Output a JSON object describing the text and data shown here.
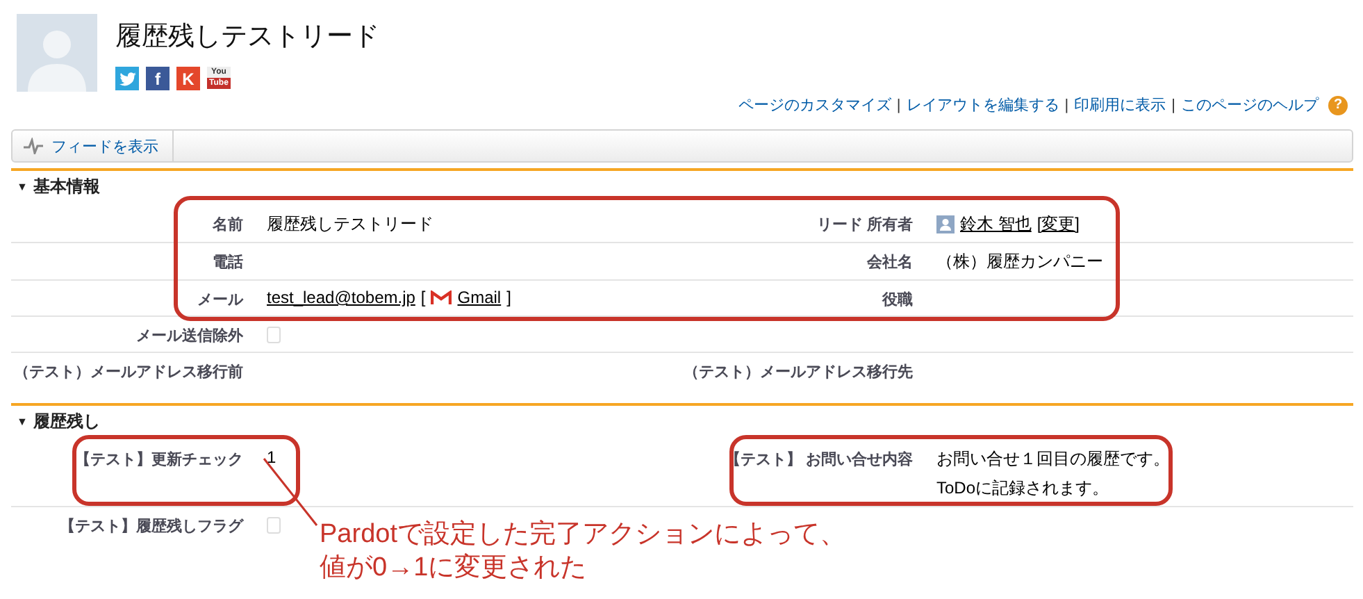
{
  "record": {
    "title": "履歴残しテストリード",
    "social_icons": [
      {
        "kind": "bird",
        "color": "#2fa6dd"
      },
      {
        "kind": "letter",
        "glyph": "f",
        "color": "#3b5998"
      },
      {
        "kind": "letter",
        "glyph": "K",
        "color": "#e4472b"
      },
      {
        "kind": "video",
        "glyph": [
          "You",
          "Tube"
        ],
        "color": "#c4302b"
      }
    ]
  },
  "header_links": {
    "separator": "|",
    "items": [
      "ページのカスタマイズ",
      "レイアウトを編集する",
      "印刷用に表示",
      "このページのヘルプ"
    ],
    "help_icon": "?"
  },
  "toolbar": {
    "button": "フィードを表示"
  },
  "sections": [
    {
      "toggle": "▼",
      "title": "基本情報",
      "rows": [
        {
          "highlighted": true,
          "left": {
            "label": "名前",
            "kind": "text",
            "value": "履歴残しテストリード"
          },
          "right": {
            "label": "リード 所有者",
            "kind": "user",
            "name": "鈴木 智也",
            "action": "[変更]"
          }
        },
        {
          "highlighted": true,
          "left": {
            "label": "電話",
            "kind": "text"
          },
          "right": {
            "label": "会社名",
            "kind": "text",
            "value": "（株）履歴カンパニー"
          }
        },
        {
          "highlighted": true,
          "left": {
            "label": "メール",
            "kind": "email",
            "value": "test_lead@tobem.jp",
            "open": "[",
            "service": "Gmail",
            "close": "]"
          },
          "right": {
            "label": "役職",
            "kind": "text"
          }
        },
        {
          "highlighted": false,
          "left": {
            "label": "メール送信除外",
            "kind": "checkbox",
            "checked": false
          }
        },
        {
          "highlighted": false,
          "left": {
            "label": "（テスト）メールアドレス移行前",
            "kind": "text"
          },
          "right": {
            "label": "（テスト）メールアドレス移行先",
            "kind": "text"
          }
        }
      ]
    },
    {
      "toggle": "▼",
      "title": "履歴残し",
      "rows": [
        {
          "left": {
            "label": "【テスト】更新チェック",
            "kind": "text",
            "value": "1",
            "highlighted": true
          },
          "right": {
            "label": "【テスト】 お問い合せ内容",
            "kind": "multiline",
            "lines": [
              "お問い合せ１回目の履歴です。",
              "ToDoに記録されます。"
            ],
            "highlighted": true
          }
        },
        {
          "left": {
            "label": "【テスト】履歴残しフラグ",
            "kind": "checkbox",
            "checked": false,
            "highlighted": false
          }
        }
      ]
    }
  ],
  "annotation": {
    "lines": [
      "Pardotで設定した完了アクションによって、",
      "値が0→1に変更された"
    ]
  }
}
